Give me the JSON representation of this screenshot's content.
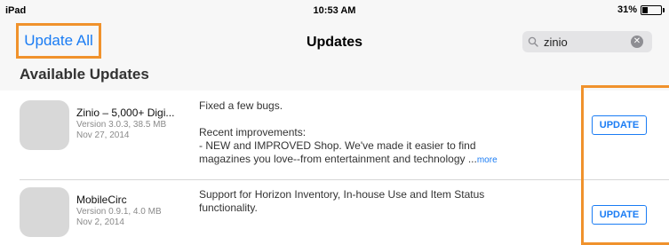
{
  "status_bar": {
    "device": "iPad",
    "time": "10:53 AM",
    "battery": "31%",
    "battery_level": 0.31
  },
  "nav": {
    "left_button": "Update All",
    "title": "Updates",
    "search": {
      "value": "zinio"
    }
  },
  "section_title": "Available Updates",
  "updates": [
    {
      "name": "Zinio – 5,000+ Digi...",
      "version": "Version 3.0.3, 38.5 MB",
      "date": "Nov 27, 2014",
      "notes_line1": "Fixed a few bugs.",
      "notes_line2": "Recent improvements:",
      "notes_line3": "- NEW and IMPROVED Shop. We've made it easier to find",
      "notes_line4": "magazines you love--from entertainment and technology ...",
      "more": "more",
      "button": "UPDATE"
    },
    {
      "name": "MobileCirc",
      "version": "Version 0.9.1, 4.0 MB",
      "date": "Nov 2, 2014",
      "notes_line1": "Support for Horizon Inventory, In-house Use and Item Status",
      "notes_line2": "functionality.",
      "button": "UPDATE"
    }
  ],
  "colors": {
    "accent": "#1a7cf4",
    "highlight": "#f0922c"
  },
  "icons": [
    "battery-icon",
    "search-icon",
    "clear-icon"
  ]
}
